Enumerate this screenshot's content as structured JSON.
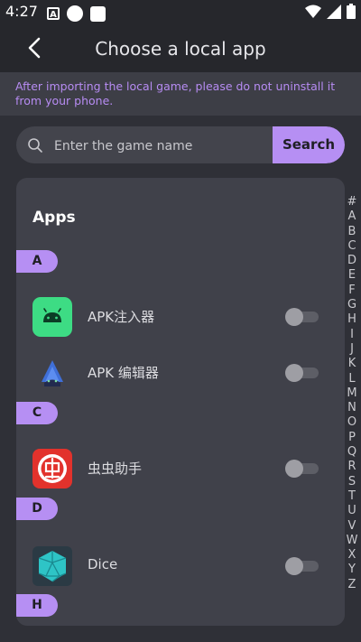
{
  "status_bar": {
    "time": "4:27",
    "notification_icon": "A"
  },
  "header": {
    "title": "Choose a local app"
  },
  "notice": {
    "text": "After importing the local game, please do not uninstall it from your phone."
  },
  "search": {
    "placeholder": "Enter the game name",
    "button_label": "Search"
  },
  "panel": {
    "title": "Apps",
    "sections": [
      {
        "letter": "A",
        "apps": [
          {
            "name": "APK注入器",
            "icon": "android-robot-icon",
            "enabled": false
          },
          {
            "name": "APK 编辑器",
            "icon": "apk-editor-icon",
            "enabled": false
          }
        ]
      },
      {
        "letter": "C",
        "apps": [
          {
            "name": "虫虫助手",
            "icon": "chongchong-icon",
            "enabled": false
          }
        ]
      },
      {
        "letter": "D",
        "apps": [
          {
            "name": "Dice",
            "icon": "dice-icon",
            "enabled": false
          }
        ]
      },
      {
        "letter": "H",
        "apps": []
      }
    ]
  },
  "alphabet_index": [
    "#",
    "A",
    "B",
    "C",
    "D",
    "E",
    "F",
    "G",
    "H",
    "I",
    "J",
    "K",
    "L",
    "M",
    "N",
    "O",
    "P",
    "Q",
    "R",
    "S",
    "T",
    "U",
    "V",
    "W",
    "X",
    "Y",
    "Z"
  ],
  "colors": {
    "accent": "#b68ff3",
    "background": "#2f3037",
    "panel": "#40414a",
    "notice_text": "#b78cf3"
  }
}
